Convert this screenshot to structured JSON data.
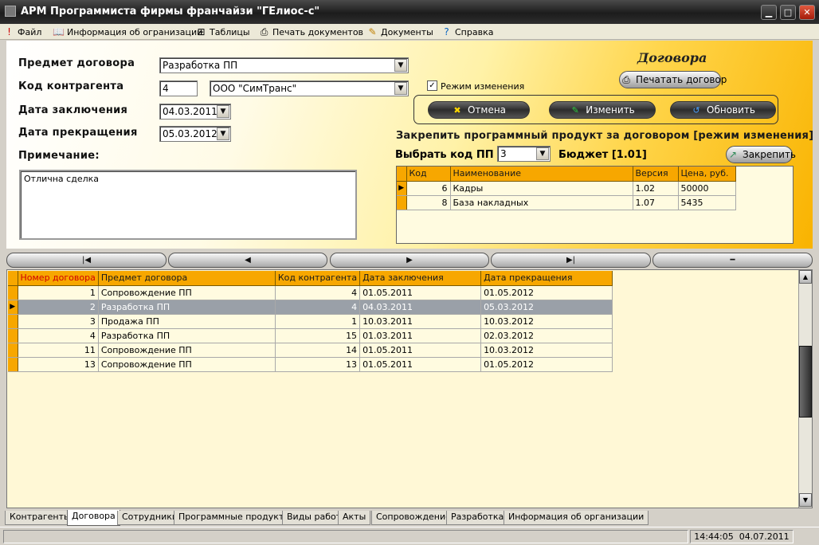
{
  "window": {
    "title": "АРМ Программиста фирмы франчайзи \"ГЕлиос-с\"",
    "min": "▁",
    "max": "□",
    "close": "✕"
  },
  "menu": [
    {
      "label": "Файл",
      "icon": "!"
    },
    {
      "label": "Информация об огранизации",
      "icon": "📖"
    },
    {
      "label": "Таблицы",
      "icon": "⊞"
    },
    {
      "label": "Печать документов",
      "icon": "⎙"
    },
    {
      "label": "Документы",
      "icon": "✎"
    },
    {
      "label": "Справка",
      "icon": "?"
    }
  ],
  "form": {
    "subject_label": "Предмет договора",
    "subject_value": "Разработка ПП",
    "contractor_label": "Код контрагента",
    "contractor_code": "4",
    "contractor_name": "ООО \"СимТранс\"",
    "start_label": "Дата заключения",
    "start_value": "04.03.2011",
    "end_label": "Дата прекращения",
    "end_value": "05.03.2012",
    "note_label": "Примечание:",
    "note_value": "Отлична сделка"
  },
  "header": {
    "title": "Договора",
    "print_button": "Печатать договор",
    "edit_mode_label": "Режим изменения",
    "edit_mode_checked": true,
    "cancel_button": "Отмена",
    "change_button": "Изменить",
    "refresh_button": "Обновить"
  },
  "attach": {
    "heading": "Закрепить программный продукт за договором [режим изменения]",
    "code_label": "Выбрать код ПП",
    "code_value": "3",
    "budget_label": "Бюджет [1.01]",
    "attach_button": "Закрепить",
    "columns": [
      "Код",
      "Наименование",
      "Версия",
      "Цена, руб."
    ],
    "rows": [
      [
        "6",
        "Кадры",
        "1.02",
        "50000"
      ],
      [
        "8",
        "База накладных",
        "1.07",
        "5435"
      ]
    ]
  },
  "nav": {
    "first": "|◀",
    "prev": "◀",
    "next": "▶",
    "last": "▶|",
    "delete": "━"
  },
  "contracts": {
    "columns": [
      "Номер договора",
      "Предмет договора",
      "Код контрагента",
      "Дата заключения",
      "Дата прекращения"
    ],
    "rows": [
      [
        "1",
        "Сопровождение ПП",
        "4",
        "01.05.2011",
        "01.05.2012"
      ],
      [
        "2",
        "Разработка ПП",
        "4",
        "04.03.2011",
        "05.03.2012"
      ],
      [
        "3",
        "Продажа ПП",
        "1",
        "10.03.2011",
        "10.03.2012"
      ],
      [
        "4",
        "Разработка ПП",
        "15",
        "01.03.2011",
        "02.03.2012"
      ],
      [
        "11",
        "Сопровождение ПП",
        "14",
        "01.05.2011",
        "10.03.2012"
      ],
      [
        "13",
        "Сопровождение ПП",
        "13",
        "01.05.2011",
        "01.05.2012"
      ]
    ],
    "selected_row": 1
  },
  "tabs": [
    "Контрагенты",
    "Договора",
    "Сотрудники",
    "Программные продукты",
    "Виды работ",
    "Акты",
    "Сопровождение",
    "Разработка",
    "Информация об организации"
  ],
  "active_tab": 1,
  "status": {
    "time": "14:44:05",
    "date": "04.07.2011"
  },
  "colors": {
    "grid_header": "#f7a700",
    "selection": "#9aa0a8",
    "grid_bg": "#fffbe0"
  }
}
